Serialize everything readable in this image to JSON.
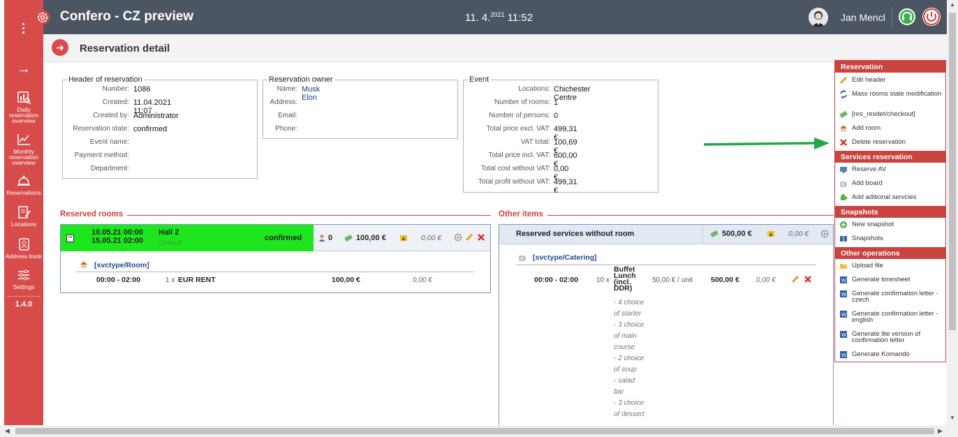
{
  "app": {
    "title": "Confero - CZ preview",
    "date": "11. 4.",
    "date_sup": "2021",
    "time": "11:52",
    "user_name": "Jan Mencl",
    "version": "1.4.0"
  },
  "sidebar": {
    "items": [
      {
        "label_lines": [
          "Daily",
          "reservation",
          "overview"
        ],
        "icon": "chart-search-icon"
      },
      {
        "label_lines": [
          "Monthly",
          "reservation",
          "overview"
        ],
        "icon": "line-chart-icon"
      },
      {
        "label_lines": [
          "Reservations"
        ],
        "icon": "bell-icon"
      },
      {
        "label_lines": [
          "Locations"
        ],
        "icon": "document-edit-icon"
      },
      {
        "label_lines": [
          "Address book"
        ],
        "icon": "address-book-icon"
      },
      {
        "label_lines": [
          "Settings"
        ],
        "icon": "sliders-icon"
      }
    ]
  },
  "page": {
    "title": "Reservation detail"
  },
  "header_of_reservation": {
    "legend": "Header of reservation",
    "rows": [
      {
        "label": "Number:",
        "value": "1086"
      },
      {
        "label": "Created:",
        "value": "11.04.2021 11:07"
      },
      {
        "label": "Created by:",
        "value": "Administrator"
      },
      {
        "label": "Reservation state:",
        "value": "confirmed"
      },
      {
        "label": "Event name:",
        "value": ""
      },
      {
        "label": "Payment method:",
        "value": ""
      },
      {
        "label": "Department:",
        "value": ""
      }
    ]
  },
  "reservation_owner": {
    "legend": "Reservation owner",
    "rows": [
      {
        "label": "Name:",
        "value": "Musk Elon"
      },
      {
        "label": "Address:",
        "value": ""
      },
      {
        "label": "Email:",
        "value": ""
      },
      {
        "label": "Phone:",
        "value": ""
      }
    ]
  },
  "event": {
    "legend": "Event",
    "rows": [
      {
        "label": "Locations:",
        "value": "Chichester Centre"
      },
      {
        "label": "Number of rooms:",
        "value": "1"
      },
      {
        "label": "Number of persons:",
        "value": "0"
      },
      {
        "label": "Total price excl. VAT:",
        "value": "499,31 €"
      },
      {
        "label": "VAT total:",
        "value": "100,69 €"
      },
      {
        "label": "Total price incl. VAT:",
        "value": "600,00 €"
      },
      {
        "label": "Total cost without VAT:",
        "value": "0,00 €"
      },
      {
        "label": "Total profit without VAT:",
        "value": "499,31 €"
      }
    ]
  },
  "reserved_rooms": {
    "title": "Reserved rooms",
    "room": {
      "date_from": "10.05.21 00:00",
      "date_to": "15.05.21 02:00",
      "name": "Hall 2",
      "subtitle": "Default",
      "state": "confirmed",
      "persons": "0",
      "price": "100,00 €",
      "cost": "0,00 €",
      "svc_type": "[svctype/Room]",
      "line": {
        "time": "00:00 - 02:00",
        "qty": "1 x",
        "name": "EUR RENT",
        "price": "100,00 €",
        "cost": "0,00 €"
      }
    }
  },
  "other_items": {
    "title": "Other items",
    "head_label": "Reserved services without room",
    "price": "500,00 €",
    "cost": "0,00 €",
    "svc_type": "[svctype/Catering]",
    "line": {
      "time": "00:00 - 02:00",
      "qty": "10 x",
      "name_lines": [
        "Buffet",
        "Lunch",
        "(incl.",
        "DDR)"
      ],
      "unit_price": "50,00 € / unit",
      "price": "500,00 €",
      "cost": "0,00 €",
      "desc_lines": [
        "- 4 choice",
        "of starter",
        "- 3 choice",
        "of main",
        "course",
        "- 2 choice",
        "of soup",
        "- salad",
        "bar",
        "- 3 choice",
        "of dessert"
      ]
    }
  },
  "actions": {
    "reservation": {
      "head": "Reservation",
      "items": [
        "Edit header",
        "Mass rooms state modification",
        "[res_resdet/checkout]",
        "Add room",
        "Delete reservation"
      ]
    },
    "services": {
      "head": "Services reservation",
      "items": [
        "Reserve AV",
        "Add board",
        "Add aditional servcies"
      ]
    },
    "snapshots": {
      "head": "Snapshots",
      "items": [
        "New snapshot",
        "Snapshots"
      ]
    },
    "other": {
      "head": "Other operations",
      "items": [
        "Upload file",
        "Generate timesheet",
        "Generate confirmation letter - czech",
        "Generate confirmation letter - english",
        "Generate lite version of confirmation letter",
        "Generate Komando"
      ]
    }
  },
  "colors": {
    "sidebar": "#d84b4b",
    "topbar": "#4b5662",
    "accent_red": "#c9433f",
    "confirmed_green": "#1ee61e",
    "arrow_green": "#22a84a"
  }
}
